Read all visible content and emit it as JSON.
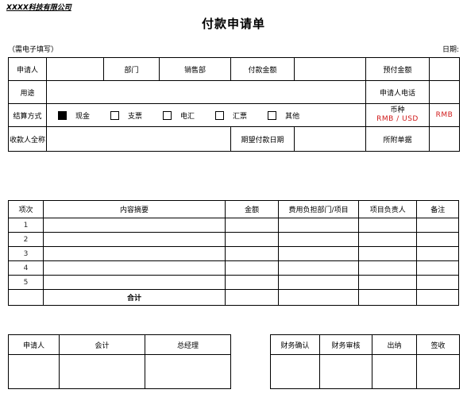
{
  "document": {
    "company_name": "XXXX科技有限公司",
    "title": "付款申请单",
    "note": "（需电子填写）",
    "date_label": "日期:"
  },
  "top_table": {
    "applicant_label": "申请人",
    "applicant_value": "",
    "department_label": "部门",
    "department_value": "销售部",
    "payment_amount_label": "付款金额",
    "payment_amount_value": "",
    "prepaid_amount_label": "预付金额",
    "prepaid_amount_value": "",
    "purpose_label": "用途",
    "purpose_value": "",
    "applicant_phone_label": "申请人电话",
    "applicant_phone_value": "",
    "settlement_label": "结算方式",
    "settlement_options": [
      {
        "label": "现金",
        "checked": true
      },
      {
        "label": "支票",
        "checked": false
      },
      {
        "label": "电汇",
        "checked": false
      },
      {
        "label": "汇票",
        "checked": false
      },
      {
        "label": "其他",
        "checked": false
      }
    ],
    "currency_label": "币种",
    "currency_options": "RMB / USD",
    "currency_value": "RMB",
    "payee_label": "收款人全称",
    "payee_value": "",
    "expected_date_label": "期望付款日期",
    "expected_date_value": "",
    "attached_docs_label": "所附单据",
    "attached_docs_value": ""
  },
  "items_table": {
    "headers": [
      "项次",
      "内容摘要",
      "金额",
      "费用负担部门/项目",
      "项目负责人",
      "备注"
    ],
    "rows": [
      {
        "index": "1",
        "summary": "",
        "amount": "",
        "dept_project": "",
        "owner": "",
        "remark": ""
      },
      {
        "index": "2",
        "summary": "",
        "amount": "",
        "dept_project": "",
        "owner": "",
        "remark": ""
      },
      {
        "index": "3",
        "summary": "",
        "amount": "",
        "dept_project": "",
        "owner": "",
        "remark": ""
      },
      {
        "index": "4",
        "summary": "",
        "amount": "",
        "dept_project": "",
        "owner": "",
        "remark": ""
      },
      {
        "index": "5",
        "summary": "",
        "amount": "",
        "dept_project": "",
        "owner": "",
        "remark": ""
      }
    ],
    "total_label": "合计",
    "total_amount": "",
    "total_dept_project": "",
    "total_owner": "",
    "total_remark": ""
  },
  "signature_left": {
    "headers": [
      "申请人",
      "会计",
      "总经理"
    ],
    "values": [
      "",
      "",
      ""
    ]
  },
  "signature_right": {
    "headers": [
      "财务确认",
      "财务审核",
      "出纳",
      "签收"
    ],
    "values": [
      "",
      "",
      "",
      ""
    ]
  },
  "colors": {
    "red_accent": "#d01a1a",
    "border": "#000000",
    "background": "#ffffff"
  }
}
